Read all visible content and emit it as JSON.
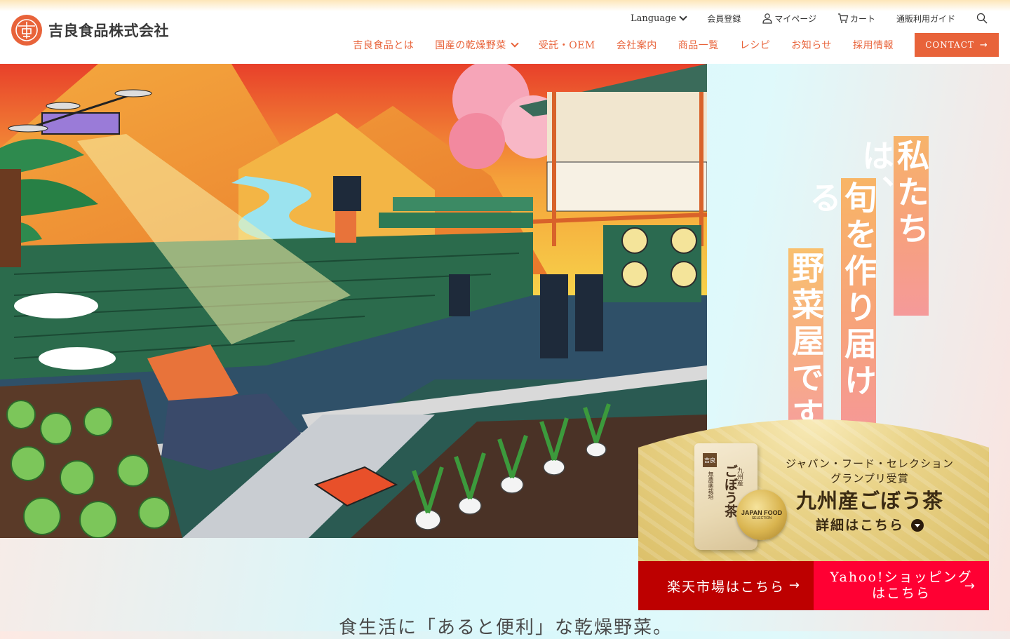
{
  "brand": {
    "name": "吉良食品株式会社"
  },
  "utility_nav": {
    "language": "Language",
    "register": "会員登録",
    "mypage": "マイページ",
    "cart": "カート",
    "guide": "通販利用ガイド"
  },
  "main_nav": {
    "items": [
      "吉良食品とは",
      "国産の乾燥野菜",
      "受託・OEM",
      "会社案内",
      "商品一覧",
      "レシピ",
      "お知らせ",
      "採用情報"
    ],
    "contact": "CONTACT"
  },
  "catch_copy": [
    "私たちは、",
    "旬を作り届ける",
    "野菜屋です"
  ],
  "award": {
    "line1": "ジャパン・フード・セレクション",
    "line2": "グランプリ受賞",
    "product": "九州産ごぼう茶",
    "details": "詳細はこちら",
    "package_title": "ごぼう茶",
    "package_sub": "九州産",
    "package_small": "無農薬栽培",
    "package_badge": "吉良",
    "medal_title": "JAPAN FOOD",
    "medal_sub": "SELECTION"
  },
  "shop_links": {
    "rakuten": "楽天市場はこちら",
    "yahoo_line1": "Yahoo!ショッピング",
    "yahoo_line2": "はこちら"
  },
  "lead": "食生活に「あると便利」な乾燥野菜。",
  "colors": {
    "accent": "#e8633a",
    "rakuten": "#bd0000",
    "yahoo": "#ff0033"
  }
}
